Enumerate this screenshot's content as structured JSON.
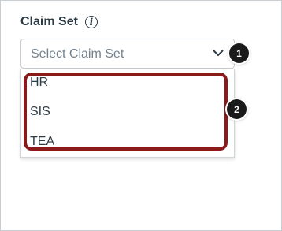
{
  "field": {
    "label": "Claim Set",
    "info_glyph": "i",
    "select_placeholder": "Select Claim Set"
  },
  "dropdown": {
    "options": [
      "HR",
      "SIS",
      "TEA"
    ]
  },
  "callouts": [
    "1",
    "2"
  ],
  "colors": {
    "highlight": "#8b1a1a",
    "text": "#2d3b45",
    "placeholder": "#73818c",
    "callout_bg": "#1a1a1a"
  },
  "icons": {
    "info": "info-icon",
    "chevron": "chevron-down-icon"
  }
}
